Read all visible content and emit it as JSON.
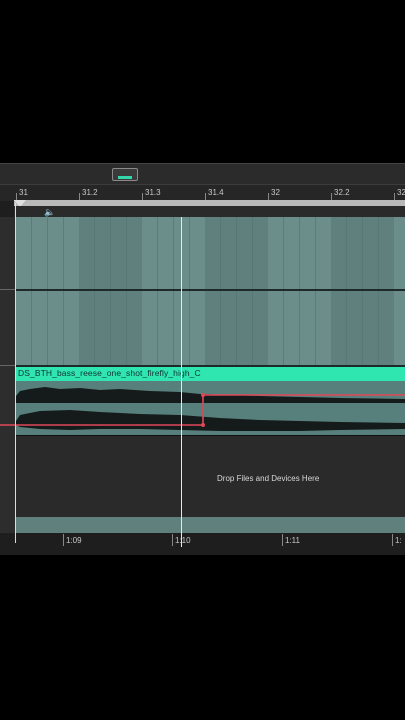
{
  "ruler": {
    "beats": [
      "31",
      "31.2",
      "31.3",
      "31.4",
      "32",
      "32.2",
      "32"
    ]
  },
  "clip": {
    "name": "DS_BTH_bass_reese_one_shot_firefly_high_C",
    "header_color": "#2fe5b0"
  },
  "dropzone": {
    "text": "Drop Files and Devices Here"
  },
  "time_ruler": {
    "labels": [
      "1:09",
      "1:10",
      "1:11",
      "1:"
    ]
  },
  "colors": {
    "automation": "#e0485a",
    "grid": "#6b8e8b",
    "background": "#000000"
  },
  "icons": {
    "speaker": "speaker-icon"
  }
}
